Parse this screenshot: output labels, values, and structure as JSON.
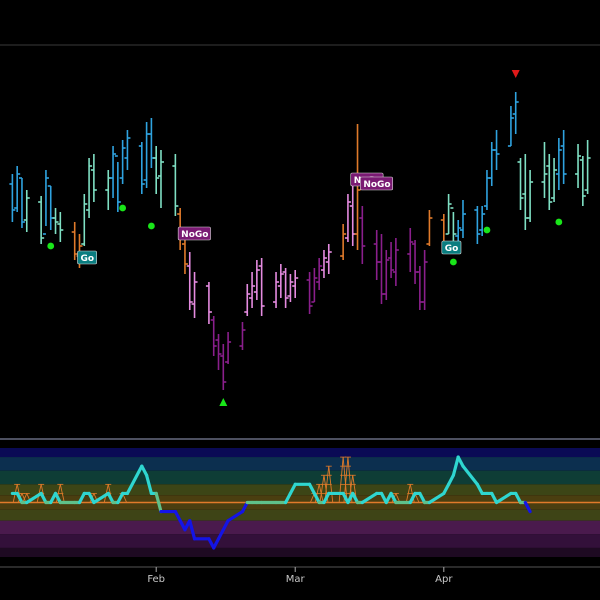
{
  "colors": {
    "go_strong": "#2fa3e0",
    "go_weak": "#7fe0c4",
    "nogo_weak": "#e58be0",
    "nogo_strong": "#8a1f8c",
    "transition": "#e07a2a",
    "go_dot": "#19e619",
    "go_arrow": "#19e619",
    "nogo_arrow": "#e01919",
    "go_label_bg": "#0a7d80",
    "nogo_label_bg": "#7a1a73",
    "oscillator_go": "#2fd6d0",
    "oscillator_nogo": "#1414e6",
    "oscillator_neutral": "#5fc08a",
    "zero_line": "#e07a2a",
    "histogram": "#e07a2a"
  },
  "chart_data": {
    "type": "bar",
    "subtype": "ohlc-go-nogo",
    "x_axis": {
      "tick_labels": [
        "Feb",
        "Mar",
        "Apr"
      ],
      "tick_dates": [
        "2024-02-01",
        "2024-03-01",
        "2024-04-01"
      ]
    },
    "bars": [
      {
        "d": "2024-01-02",
        "h": 148,
        "l": 124,
        "o": 143,
        "c": 130,
        "t": "gs"
      },
      {
        "d": "2024-01-03",
        "h": 152,
        "l": 129,
        "o": 131,
        "c": 148,
        "t": "gs"
      },
      {
        "d": "2024-01-04",
        "h": 146,
        "l": 121,
        "o": 146,
        "c": 124,
        "t": "gs"
      },
      {
        "d": "2024-01-05",
        "h": 140,
        "l": 119,
        "o": 125,
        "c": 136,
        "t": "gw"
      },
      {
        "d": "2024-01-08",
        "h": 137,
        "l": 113,
        "o": 134,
        "c": 116,
        "t": "gw"
      },
      {
        "d": "2024-01-09",
        "h": 150,
        "l": 122,
        "o": 118,
        "c": 146,
        "t": "gs"
      },
      {
        "d": "2024-01-10",
        "h": 142,
        "l": 120,
        "o": 142,
        "c": 126,
        "t": "gs"
      },
      {
        "d": "2024-01-11",
        "h": 131,
        "l": 118,
        "o": 126,
        "c": 124,
        "t": "gw"
      },
      {
        "d": "2024-01-12",
        "h": 129,
        "l": 114,
        "o": 123,
        "c": 120,
        "t": "gw"
      },
      {
        "d": "2024-01-15",
        "h": 124,
        "l": 105,
        "o": 119,
        "c": 108,
        "t": "tr"
      },
      {
        "d": "2024-01-16",
        "h": 118,
        "l": 101,
        "o": 107,
        "c": 112,
        "t": "tr"
      },
      {
        "d": "2024-01-17",
        "h": 138,
        "l": 112,
        "o": 113,
        "c": 133,
        "t": "gw"
      },
      {
        "d": "2024-01-18",
        "h": 156,
        "l": 126,
        "o": 130,
        "c": 152,
        "t": "gw"
      },
      {
        "d": "2024-01-19",
        "h": 158,
        "l": 134,
        "o": 150,
        "c": 140,
        "t": "gw"
      },
      {
        "d": "2024-01-22",
        "h": 150,
        "l": 130,
        "o": 140,
        "c": 146,
        "t": "gw"
      },
      {
        "d": "2024-01-23",
        "h": 162,
        "l": 136,
        "o": 146,
        "c": 158,
        "t": "gs"
      },
      {
        "d": "2024-01-24",
        "h": 154,
        "l": 129,
        "o": 157,
        "c": 134,
        "t": "gs"
      },
      {
        "d": "2024-01-25",
        "h": 165,
        "l": 143,
        "o": 146,
        "c": 161,
        "t": "gs"
      },
      {
        "d": "2024-01-26",
        "h": 170,
        "l": 150,
        "o": 156,
        "c": 166,
        "t": "gs"
      },
      {
        "d": "2024-01-29",
        "h": 164,
        "l": 138,
        "o": 162,
        "c": 143,
        "t": "gs"
      },
      {
        "d": "2024-01-30",
        "h": 174,
        "l": 141,
        "o": 145,
        "c": 168,
        "t": "gs"
      },
      {
        "d": "2024-01-31",
        "h": 176,
        "l": 151,
        "o": 168,
        "c": 156,
        "t": "gs"
      },
      {
        "d": "2024-02-01",
        "h": 162,
        "l": 138,
        "o": 156,
        "c": 146,
        "t": "gw"
      },
      {
        "d": "2024-02-02",
        "h": 160,
        "l": 131,
        "o": 147,
        "c": 154,
        "t": "gw"
      },
      {
        "d": "2024-02-05",
        "h": 158,
        "l": 127,
        "o": 152,
        "c": 132,
        "t": "gw"
      },
      {
        "d": "2024-02-06",
        "h": 131,
        "l": 110,
        "o": 128,
        "c": 116,
        "t": "tr"
      },
      {
        "d": "2024-02-07",
        "h": 118,
        "l": 98,
        "o": 113,
        "c": 103,
        "t": "tr"
      },
      {
        "d": "2024-02-08",
        "h": 109,
        "l": 80,
        "o": 102,
        "c": 84,
        "t": "nw"
      },
      {
        "d": "2024-02-09",
        "h": 99,
        "l": 76,
        "o": 83,
        "c": 94,
        "t": "nw"
      },
      {
        "d": "2024-02-12",
        "h": 94,
        "l": 73,
        "o": 92,
        "c": 79,
        "t": "nw"
      },
      {
        "d": "2024-02-13",
        "h": 77,
        "l": 57,
        "o": 75,
        "c": 62,
        "t": "ns"
      },
      {
        "d": "2024-02-14",
        "h": 68,
        "l": 50,
        "o": 65,
        "c": 58,
        "t": "ns"
      },
      {
        "d": "2024-02-15",
        "h": 63,
        "l": 40,
        "o": 57,
        "c": 44,
        "t": "ns"
      },
      {
        "d": "2024-02-16",
        "h": 69,
        "l": 53,
        "o": 54,
        "c": 64,
        "t": "ns"
      },
      {
        "d": "2024-02-19",
        "h": 74,
        "l": 60,
        "o": 62,
        "c": 70,
        "t": "ns"
      },
      {
        "d": "2024-02-20",
        "h": 93,
        "l": 77,
        "o": 79,
        "c": 88,
        "t": "nw"
      },
      {
        "d": "2024-02-21",
        "h": 99,
        "l": 81,
        "o": 86,
        "c": 92,
        "t": "nw"
      },
      {
        "d": "2024-02-22",
        "h": 105,
        "l": 85,
        "o": 89,
        "c": 100,
        "t": "nw"
      },
      {
        "d": "2024-02-23",
        "h": 106,
        "l": 77,
        "o": 102,
        "c": 82,
        "t": "nw"
      },
      {
        "d": "2024-02-26",
        "h": 99,
        "l": 81,
        "o": 84,
        "c": 94,
        "t": "nw"
      },
      {
        "d": "2024-02-27",
        "h": 103,
        "l": 86,
        "o": 92,
        "c": 98,
        "t": "nw"
      },
      {
        "d": "2024-02-28",
        "h": 101,
        "l": 81,
        "o": 99,
        "c": 86,
        "t": "nw"
      },
      {
        "d": "2024-02-29",
        "h": 98,
        "l": 84,
        "o": 87,
        "c": 94,
        "t": "nw"
      },
      {
        "d": "2024-03-01",
        "h": 100,
        "l": 86,
        "o": 92,
        "c": 96,
        "t": "nw"
      },
      {
        "d": "2024-03-04",
        "h": 99,
        "l": 78,
        "o": 95,
        "c": 82,
        "t": "ns"
      },
      {
        "d": "2024-03-05",
        "h": 101,
        "l": 84,
        "o": 84,
        "c": 96,
        "t": "ns"
      },
      {
        "d": "2024-03-06",
        "h": 106,
        "l": 90,
        "o": 94,
        "c": 102,
        "t": "ns"
      },
      {
        "d": "2024-03-07",
        "h": 110,
        "l": 96,
        "o": 100,
        "c": 106,
        "t": "nw"
      },
      {
        "d": "2024-03-08",
        "h": 113,
        "l": 98,
        "o": 104,
        "c": 109,
        "t": "nw"
      },
      {
        "d": "2024-03-11",
        "h": 123,
        "l": 105,
        "o": 107,
        "c": 118,
        "t": "tr"
      },
      {
        "d": "2024-03-12",
        "h": 138,
        "l": 114,
        "o": 116,
        "c": 134,
        "t": "nw"
      },
      {
        "d": "2024-03-13",
        "h": 142,
        "l": 112,
        "o": 132,
        "c": 118,
        "t": "nw"
      },
      {
        "d": "2024-03-14",
        "h": 173,
        "l": 110,
        "o": 118,
        "c": 140,
        "t": "tr"
      },
      {
        "d": "2024-03-15",
        "h": 132,
        "l": 103,
        "o": 126,
        "c": 112,
        "t": "ns"
      },
      {
        "d": "2024-03-18",
        "h": 120,
        "l": 95,
        "o": 113,
        "c": 104,
        "t": "ns"
      },
      {
        "d": "2024-03-19",
        "h": 118,
        "l": 83,
        "o": 104,
        "c": 88,
        "t": "ns"
      },
      {
        "d": "2024-03-20",
        "h": 110,
        "l": 85,
        "o": 88,
        "c": 105,
        "t": "ns"
      },
      {
        "d": "2024-03-21",
        "h": 114,
        "l": 96,
        "o": 106,
        "c": 100,
        "t": "ns"
      },
      {
        "d": "2024-03-22",
        "h": 116,
        "l": 92,
        "o": 99,
        "c": 110,
        "t": "ns"
      },
      {
        "d": "2024-03-25",
        "h": 121,
        "l": 99,
        "o": 108,
        "c": 114,
        "t": "ns"
      },
      {
        "d": "2024-03-26",
        "h": 115,
        "l": 93,
        "o": 113,
        "c": 99,
        "t": "ns"
      },
      {
        "d": "2024-03-27",
        "h": 102,
        "l": 80,
        "o": 99,
        "c": 84,
        "t": "ns"
      },
      {
        "d": "2024-03-28",
        "h": 110,
        "l": 80,
        "o": 84,
        "c": 104,
        "t": "ns"
      },
      {
        "d": "2024-03-29",
        "h": 130,
        "l": 112,
        "o": 113,
        "c": 126,
        "t": "tr"
      },
      {
        "d": "2024-04-01",
        "h": 128,
        "l": 110,
        "o": 125,
        "c": 114,
        "t": "tr"
      },
      {
        "d": "2024-04-02",
        "h": 138,
        "l": 118,
        "o": 118,
        "c": 133,
        "t": "gw"
      },
      {
        "d": "2024-04-03",
        "h": 129,
        "l": 113,
        "o": 131,
        "c": 118,
        "t": "gw"
      },
      {
        "d": "2024-04-04",
        "h": 125,
        "l": 114,
        "o": 117,
        "c": 121,
        "t": "gs"
      },
      {
        "d": "2024-04-05",
        "h": 135,
        "l": 116,
        "o": 120,
        "c": 128,
        "t": "gs"
      },
      {
        "d": "2024-04-08",
        "h": 132,
        "l": 113,
        "o": 130,
        "c": 118,
        "t": "gs"
      },
      {
        "d": "2024-04-09",
        "h": 132,
        "l": 117,
        "o": 120,
        "c": 128,
        "t": "gs"
      },
      {
        "d": "2024-04-10",
        "h": 150,
        "l": 130,
        "o": 132,
        "c": 146,
        "t": "gs"
      },
      {
        "d": "2024-04-11",
        "h": 164,
        "l": 142,
        "o": 146,
        "c": 160,
        "t": "gs"
      },
      {
        "d": "2024-04-12",
        "h": 170,
        "l": 150,
        "o": 160,
        "c": 158,
        "t": "gs"
      },
      {
        "d": "2024-04-15",
        "h": 182,
        "l": 162,
        "o": 162,
        "c": 176,
        "t": "gs"
      },
      {
        "d": "2024-04-16",
        "h": 189,
        "l": 168,
        "o": 178,
        "c": 184,
        "t": "gs"
      },
      {
        "d": "2024-04-17",
        "h": 156,
        "l": 130,
        "o": 154,
        "c": 136,
        "t": "gw"
      },
      {
        "d": "2024-04-18",
        "h": 158,
        "l": 120,
        "o": 138,
        "c": 126,
        "t": "gw"
      },
      {
        "d": "2024-04-19",
        "h": 150,
        "l": 124,
        "o": 126,
        "c": 144,
        "t": "gw"
      },
      {
        "d": "2024-04-22",
        "h": 164,
        "l": 136,
        "o": 144,
        "c": 148,
        "t": "gw"
      },
      {
        "d": "2024-04-23",
        "h": 158,
        "l": 130,
        "o": 152,
        "c": 134,
        "t": "gw"
      },
      {
        "d": "2024-04-24",
        "h": 156,
        "l": 134,
        "o": 136,
        "c": 150,
        "t": "gw"
      },
      {
        "d": "2024-04-25",
        "h": 166,
        "l": 140,
        "o": 148,
        "c": 160,
        "t": "gs"
      },
      {
        "d": "2024-04-26",
        "h": 170,
        "l": 143,
        "o": 162,
        "c": 148,
        "t": "gs"
      },
      {
        "d": "2024-04-29",
        "h": 163,
        "l": 141,
        "o": 148,
        "c": 157,
        "t": "gw"
      },
      {
        "d": "2024-04-30",
        "h": 157,
        "l": 132,
        "o": 155,
        "c": 137,
        "t": "gw"
      },
      {
        "d": "2024-05-01",
        "h": 165,
        "l": 138,
        "o": 140,
        "c": 156,
        "t": "gw"
      }
    ],
    "go_dots": [
      {
        "d": "2024-01-10",
        "v": 112
      },
      {
        "d": "2024-01-25",
        "v": 131
      },
      {
        "d": "2024-01-31",
        "v": 122
      },
      {
        "d": "2024-04-03",
        "v": 104
      },
      {
        "d": "2024-04-10",
        "v": 120
      },
      {
        "d": "2024-04-25",
        "v": 124
      }
    ],
    "arrows": [
      {
        "type": "go",
        "d": "2024-02-15",
        "v": 34
      },
      {
        "type": "nogo",
        "d": "2024-04-16",
        "v": 198
      }
    ],
    "labels": [
      {
        "text": "Go",
        "d": "2024-01-16",
        "v": 106
      },
      {
        "text": "NoGo",
        "d": "2024-02-06",
        "v": 118
      },
      {
        "text": "NoGo",
        "d": "2024-03-13",
        "v": 145
      },
      {
        "text": "NoGo",
        "d": "2024-03-15",
        "v": 143
      },
      {
        "text": "Go",
        "d": "2024-04-01",
        "v": 111
      }
    ],
    "oscillator": {
      "ylim": [
        -6,
        6
      ],
      "zones": [
        {
          "from": 5,
          "to": 6,
          "color": "#0a0a55"
        },
        {
          "from": 3.5,
          "to": 5,
          "color": "#0c2f4f"
        },
        {
          "from": 2,
          "to": 3.5,
          "color": "#0e3d36"
        },
        {
          "from": 0.8,
          "to": 2,
          "color": "#3c4516"
        },
        {
          "from": -0.8,
          "to": 0.8,
          "color": "#4a3e10"
        },
        {
          "from": -2,
          "to": -0.8,
          "color": "#3e4416"
        },
        {
          "from": -3.5,
          "to": -2,
          "color": "#4a1a4d"
        },
        {
          "from": -5,
          "to": -3.5,
          "color": "#33103a"
        },
        {
          "from": -6,
          "to": -5,
          "color": "#1e0a22"
        }
      ],
      "values": [
        1,
        1,
        0,
        0,
        1,
        0,
        0,
        1,
        0,
        0,
        0,
        1,
        1,
        0,
        1,
        0,
        0,
        1,
        1,
        4,
        3,
        1,
        1,
        -1,
        -1,
        -2,
        -3,
        -2,
        -4,
        -4,
        -5,
        -4,
        -3,
        -2,
        -1,
        0,
        0,
        0,
        0,
        0,
        0,
        0,
        1,
        2,
        2,
        1,
        0,
        0,
        1,
        1,
        0,
        1,
        0,
        0,
        1,
        1,
        0,
        1,
        0,
        0,
        1,
        1,
        0,
        0,
        1,
        2,
        3,
        5,
        4,
        2,
        1,
        1,
        1,
        0,
        1,
        1,
        0,
        0,
        -1
      ],
      "histogram": [
        0,
        2,
        1,
        1,
        2,
        0,
        0,
        0,
        2,
        0,
        0,
        0,
        0,
        1,
        2,
        0,
        0,
        1,
        0,
        0,
        0,
        0,
        0,
        0,
        0,
        0,
        0,
        0,
        0,
        0,
        0,
        0,
        0,
        0,
        0,
        0,
        0,
        0,
        0,
        0,
        0,
        0,
        0,
        0,
        0,
        1,
        2,
        3,
        4,
        5,
        5,
        3,
        0,
        0,
        0,
        0,
        0,
        0,
        1,
        2,
        1,
        0,
        0,
        0,
        0,
        0,
        0,
        0,
        0,
        0,
        0,
        0,
        0,
        0,
        0,
        0,
        0,
        0,
        0
      ]
    }
  }
}
